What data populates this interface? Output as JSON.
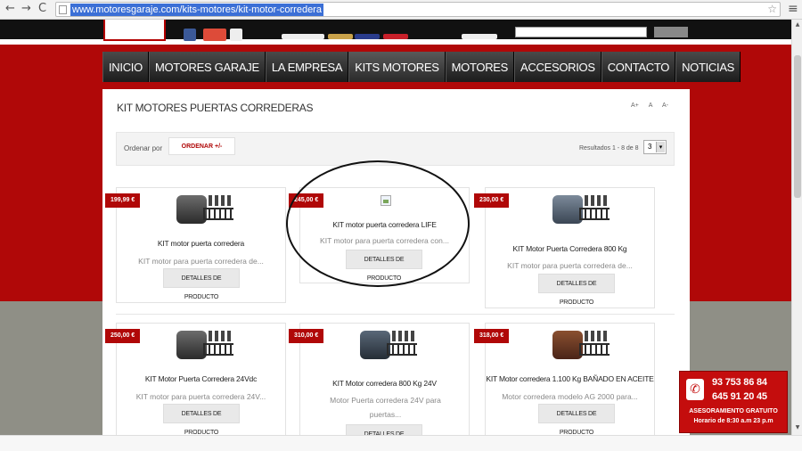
{
  "browser": {
    "back": "←",
    "forward": "→",
    "reload": "C",
    "url": "www.motoresgaraje.com/kits-motores/kit-motor-corredera",
    "star": "☆",
    "menu": "≡"
  },
  "nav": {
    "items": [
      "INICIO",
      "MOTORES GARAJE",
      "LA EMPRESA",
      "KITS MOTORES",
      "MOTORES",
      "ACCESORIOS",
      "CONTACTO",
      "NOTICIAS"
    ],
    "active": "KITS MOTORES"
  },
  "section": {
    "title": "KIT MOTORES PUERTAS CORREDERAS",
    "font_controls": [
      "A+",
      "A",
      "A-"
    ]
  },
  "sort": {
    "label": "Ordenar por",
    "button": "ORDENAR +/-",
    "results": "Resultados 1 - 8 de 8",
    "page": "3",
    "arrow": "▾"
  },
  "products": [
    {
      "price": "199,99 €",
      "title": "KIT motor puerta corredera",
      "desc": "KIT motor para puerta corredera de...",
      "button": "DETALLES DE PRODUCTO",
      "image": "motor-kit-image"
    },
    {
      "price": "245,00 €",
      "title": "KIT motor puerta corredera LIFE",
      "desc": "KIT motor para puerta corredera con...",
      "button": "DETALLES DE PRODUCTO",
      "image": "broken-image-icon"
    },
    {
      "price": "230,00 €",
      "title": "KIT Motor Puerta Corredera 800 Kg",
      "desc": "KIT motor para puerta corredera de...",
      "button": "DETALLES DE PRODUCTO",
      "image": "motor-kit-image"
    },
    {
      "price": "250,00 €",
      "title": "KIT Motor Puerta Corredera 24Vdc",
      "desc": "KIT motor para puerta corredera 24V...",
      "button": "DETALLES DE PRODUCTO",
      "image": "motor-kit-image"
    },
    {
      "price": "310,00 €",
      "title": "KIT Motor corredera 800 Kg 24V",
      "desc": "Motor Puerta corredera 24V para puertas...",
      "button": "DETALLES DE PRODUCTO",
      "image": "motor-kit-image"
    },
    {
      "price": "318,00 €",
      "title": "KIT Motor corredera 1.100 Kg BAÑADO EN ACEITE",
      "desc": "Motor corredera modelo AG 2000 para...",
      "button": "DETALLES DE PRODUCTO",
      "image": "motor-kit-image"
    }
  ],
  "contact": {
    "phone_icon": "✆",
    "phone1": "93 753 86 84",
    "phone2": "645 91 20 45",
    "label": "ASESORAMIENTO GRATUITO",
    "hours": "Horario de 8:30 a.m 23 p.m"
  },
  "colors": {
    "brand_red": "#b00808",
    "nav_dark": "#1c1c1c",
    "grey_band": "#8f8f86"
  }
}
